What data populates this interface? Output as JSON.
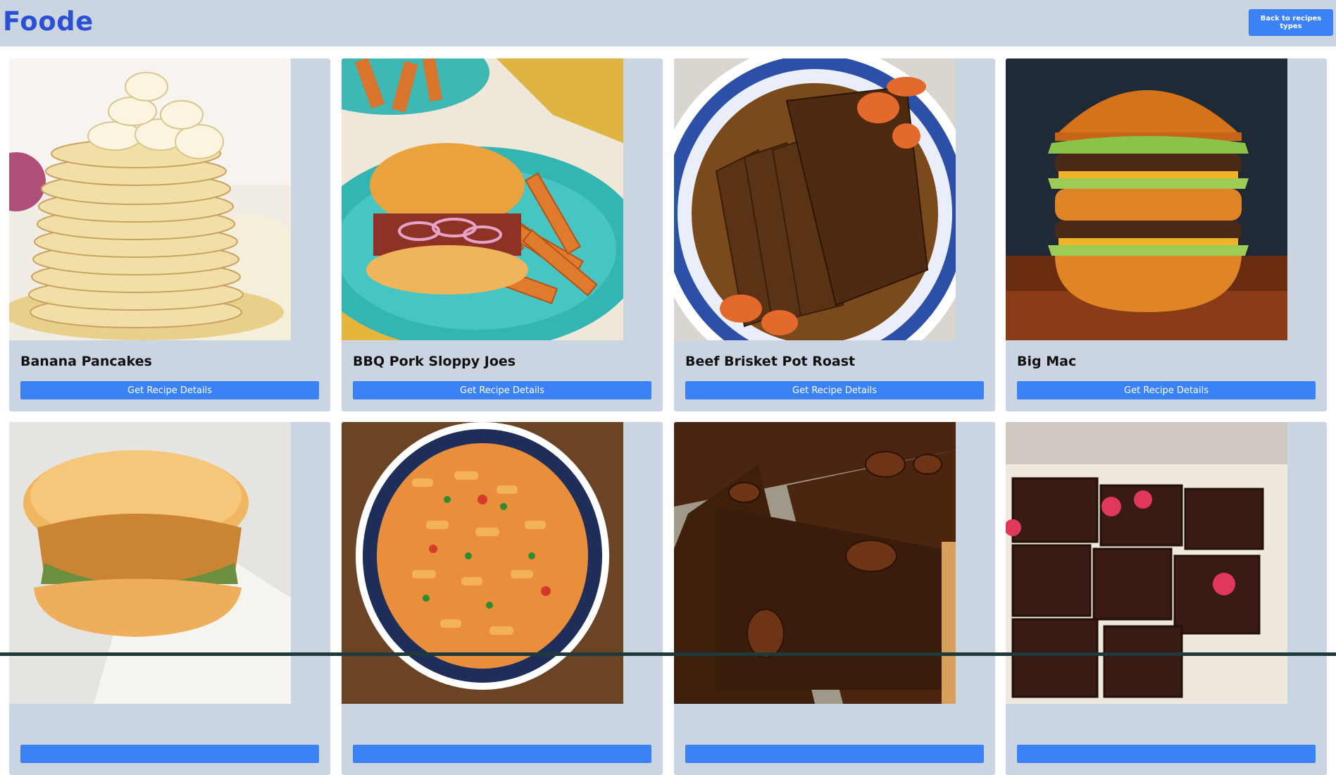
{
  "app": {
    "brand": "Foode",
    "back_button_label": "Back to recipes types"
  },
  "recipes": [
    {
      "name": "Banana Pancakes",
      "button_label": "Get Recipe Details",
      "image": "banana-pancakes-photo"
    },
    {
      "name": "BBQ Pork Sloppy Joes",
      "button_label": "Get Recipe Details",
      "image": "sloppy-joes-photo"
    },
    {
      "name": "Beef Brisket Pot Roast",
      "button_label": "Get Recipe Details",
      "image": "brisket-photo"
    },
    {
      "name": "Big Mac",
      "button_label": "Get Recipe Details",
      "image": "big-mac-photo"
    },
    {
      "name": "",
      "button_label": "",
      "image": "chicken-sandwich-photo"
    },
    {
      "name": "",
      "button_label": "",
      "image": "pasta-bowl-photo"
    },
    {
      "name": "",
      "button_label": "",
      "image": "pecan-pie-photo"
    },
    {
      "name": "",
      "button_label": "",
      "image": "brownies-photo"
    }
  ],
  "colors": {
    "header_bg": "#cbd5e1",
    "brand": "#2b50d6",
    "accent": "#3b82f6",
    "card_bg": "#cbd5e1"
  }
}
